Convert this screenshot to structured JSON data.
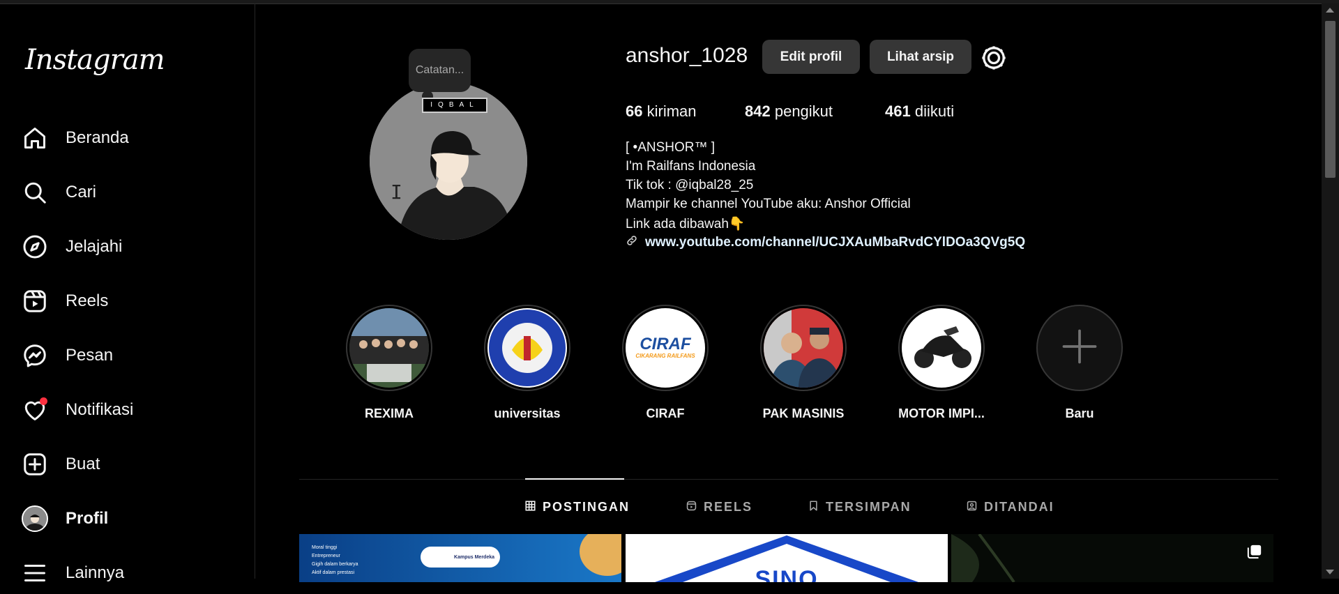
{
  "sidebar": {
    "logo": "Instagram",
    "items": [
      {
        "label": "Beranda",
        "icon": "home-icon"
      },
      {
        "label": "Cari",
        "icon": "search-icon"
      },
      {
        "label": "Jelajahi",
        "icon": "compass-icon"
      },
      {
        "label": "Reels",
        "icon": "reels-icon"
      },
      {
        "label": "Pesan",
        "icon": "messenger-icon"
      },
      {
        "label": "Notifikasi",
        "icon": "heart-icon"
      },
      {
        "label": "Buat",
        "icon": "plus-square-icon"
      },
      {
        "label": "Profil",
        "icon": "avatar"
      },
      {
        "label": "Lainnya",
        "icon": "menu-icon"
      }
    ]
  },
  "profile": {
    "note_placeholder": "Catatan...",
    "avatar_tag": "IQBAL",
    "username": "anshor_1028",
    "edit_button": "Edit profil",
    "archive_button": "Lihat arsip",
    "stats": {
      "posts_count": "66",
      "posts_label": "kiriman",
      "followers_count": "842",
      "followers_label": "pengikut",
      "following_count": "461",
      "following_label": "diikuti"
    },
    "bio": {
      "line1": "[ •ANSHOR™ ]",
      "line2": "I'm Railfans Indonesia",
      "line3": "Tik tok : @iqbal28_25",
      "line4": "Mampir ke channel YouTube aku: Anshor Official",
      "line5": "Link ada dibawah👇",
      "link": "www.youtube.com/channel/UCJXAuMbaRvdCYlDOa3QVg5Q"
    }
  },
  "highlights": [
    {
      "name": "REXIMA"
    },
    {
      "name": "universitas"
    },
    {
      "name": "CIRAF",
      "text1": "CIRAF",
      "text2": "CIKARANG RAILFANS"
    },
    {
      "name": "PAK MASINIS"
    },
    {
      "name": "MOTOR IMPI..."
    },
    {
      "name": "Baru"
    }
  ],
  "tabs": [
    {
      "label": "POSTINGAN",
      "icon": "grid-icon"
    },
    {
      "label": "REELS",
      "icon": "reels-icon"
    },
    {
      "label": "TERSIMPAN",
      "icon": "bookmark-icon"
    },
    {
      "label": "DITANDAI",
      "icon": "tagged-icon"
    }
  ],
  "posts": {
    "post1_lines": [
      "Moral tinggi",
      "Entrepreneur",
      "Gigih dalam berkarya",
      "Aktif dalam prestasi"
    ],
    "post1_badge": "Kampus Merdeka",
    "post2_text": "SINO"
  },
  "colors": {
    "background": "#000000",
    "button": "#363636",
    "notification_dot": "#ff3040",
    "link": "#e0f1ff"
  }
}
